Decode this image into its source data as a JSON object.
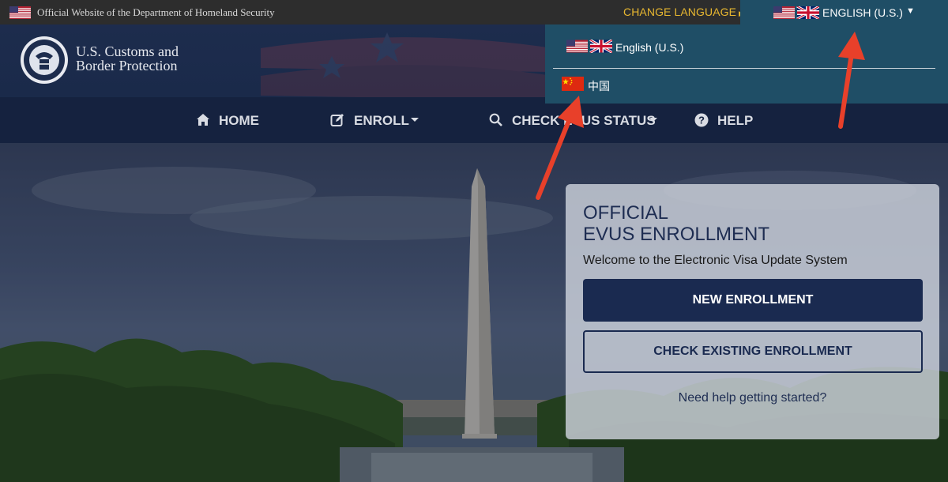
{
  "govbar": {
    "official_text": "Official Website of the Department of Homeland Security",
    "change_language": "CHANGE LANGUAGE",
    "current_language": "ENGLISH (U.S.)"
  },
  "header": {
    "agency_line1": "U.S. Customs and",
    "agency_line2": "Border Protection"
  },
  "nav": {
    "home": "HOME",
    "enroll": "ENROLL",
    "check_status": "CHECK EVUS STATUS",
    "help": "HELP"
  },
  "language_dropdown": {
    "options": [
      {
        "label": "English (U.S.)",
        "flags": [
          "us-flag-icon",
          "uk-flag-icon"
        ]
      },
      {
        "label": "中国",
        "flags": [
          "china-flag-icon"
        ]
      }
    ]
  },
  "card": {
    "title_line1": "OFFICIAL",
    "title_line2": "EVUS ENROLLMENT",
    "subtitle": "Welcome to the Electronic Visa Update System",
    "new_enrollment": "NEW ENROLLMENT",
    "check_existing": "CHECK EXISTING ENROLLMENT",
    "help_link": "Need help getting started?"
  },
  "colors": {
    "navy": "#1a2a50",
    "dropdown_teal": "#1f4e66",
    "change_language_gold": "#e8b730",
    "annotation_red": "#e8402a"
  }
}
